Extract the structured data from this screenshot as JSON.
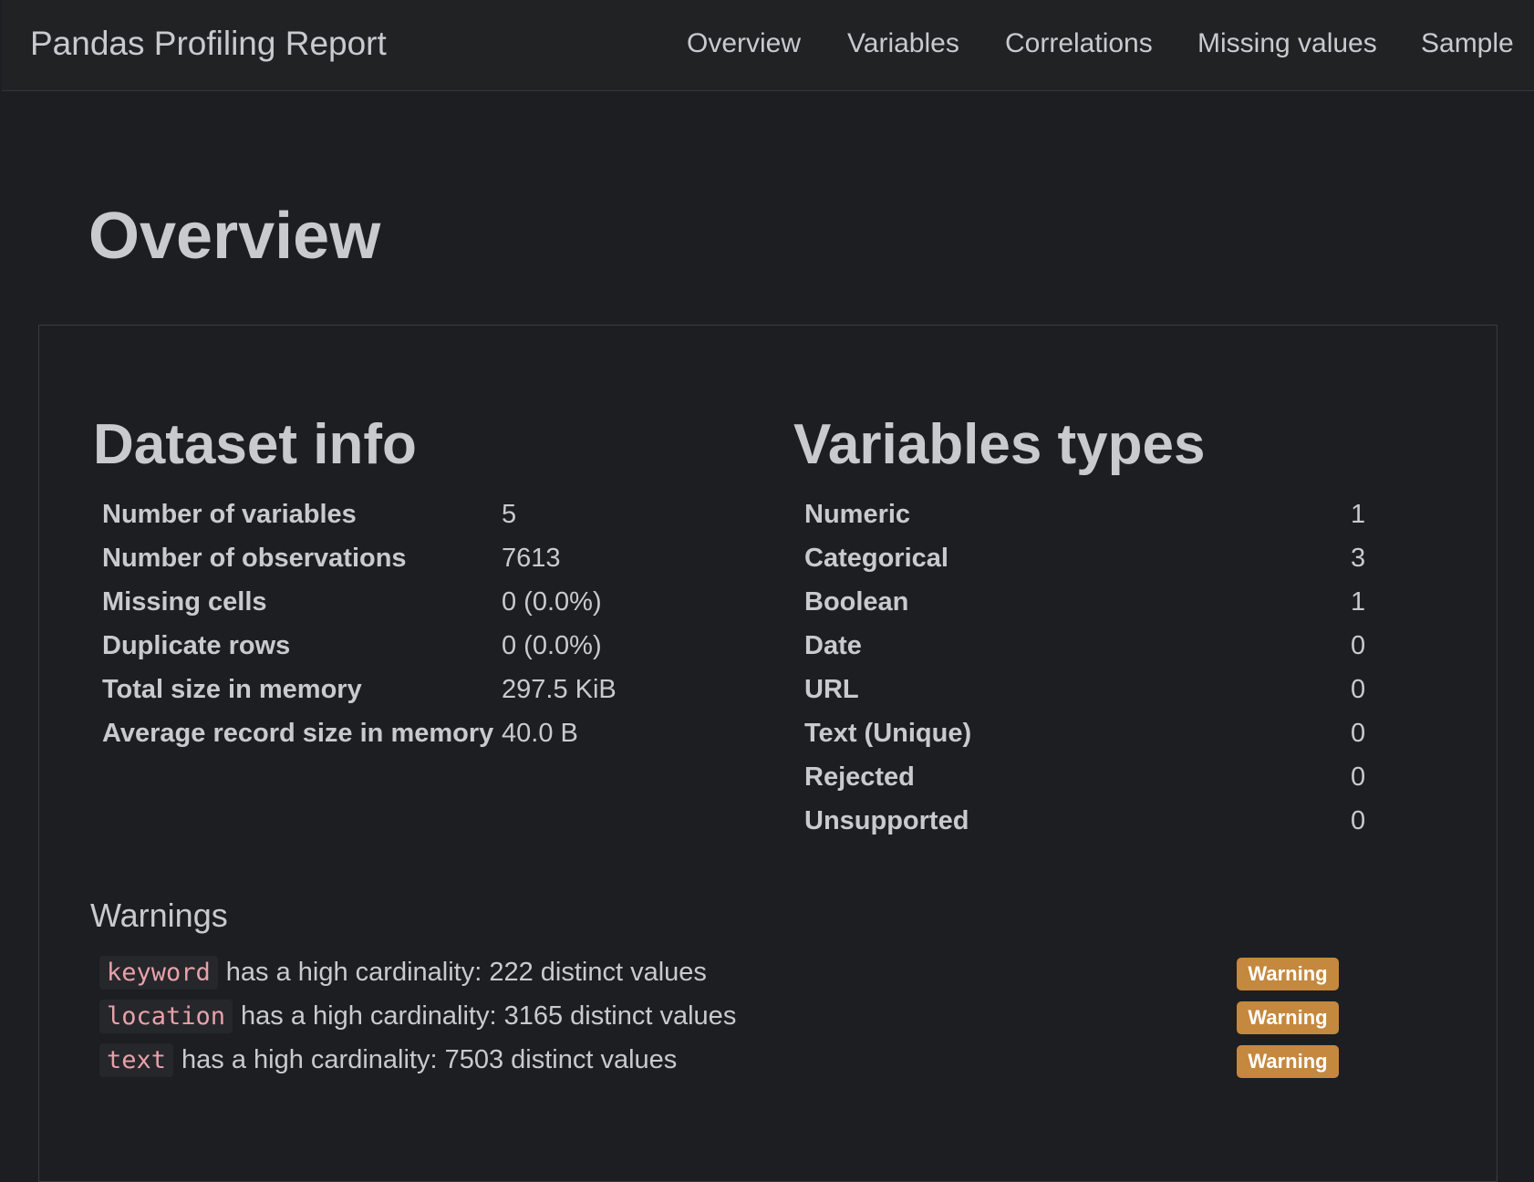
{
  "navbar": {
    "brand": "Pandas Profiling Report",
    "links": [
      "Overview",
      "Variables",
      "Correlations",
      "Missing values",
      "Sample"
    ]
  },
  "page_title": "Overview",
  "dataset_info": {
    "title": "Dataset info",
    "rows": [
      {
        "label": "Number of variables",
        "value": "5"
      },
      {
        "label": "Number of observations",
        "value": "7613"
      },
      {
        "label": "Missing cells",
        "value": "0 (0.0%)"
      },
      {
        "label": "Duplicate rows",
        "value": "0 (0.0%)"
      },
      {
        "label": "Total size in memory",
        "value": "297.5 KiB"
      },
      {
        "label": "Average record size in memory",
        "value": "40.0 B"
      }
    ]
  },
  "variable_types": {
    "title": "Variables types",
    "rows": [
      {
        "label": "Numeric",
        "value": "1"
      },
      {
        "label": "Categorical",
        "value": "3"
      },
      {
        "label": "Boolean",
        "value": "1"
      },
      {
        "label": "Date",
        "value": "0"
      },
      {
        "label": "URL",
        "value": "0"
      },
      {
        "label": "Text (Unique)",
        "value": "0"
      },
      {
        "label": "Rejected",
        "value": "0"
      },
      {
        "label": "Unsupported",
        "value": "0"
      }
    ]
  },
  "warnings": {
    "title": "Warnings",
    "items": [
      {
        "variable": "keyword",
        "message": "has a high cardinality: 222 distinct values",
        "badge": "Warning"
      },
      {
        "variable": "location",
        "message": "has a high cardinality: 3165 distinct values",
        "badge": "Warning"
      },
      {
        "variable": "text",
        "message": "has a high cardinality: 7503 distinct values",
        "badge": "Warning"
      }
    ]
  },
  "colors": {
    "background": "#1d1e21",
    "navbar": "#212224",
    "text": "#c9cacd",
    "code": "#e8a1aa",
    "warning_badge": "#c4883f"
  }
}
